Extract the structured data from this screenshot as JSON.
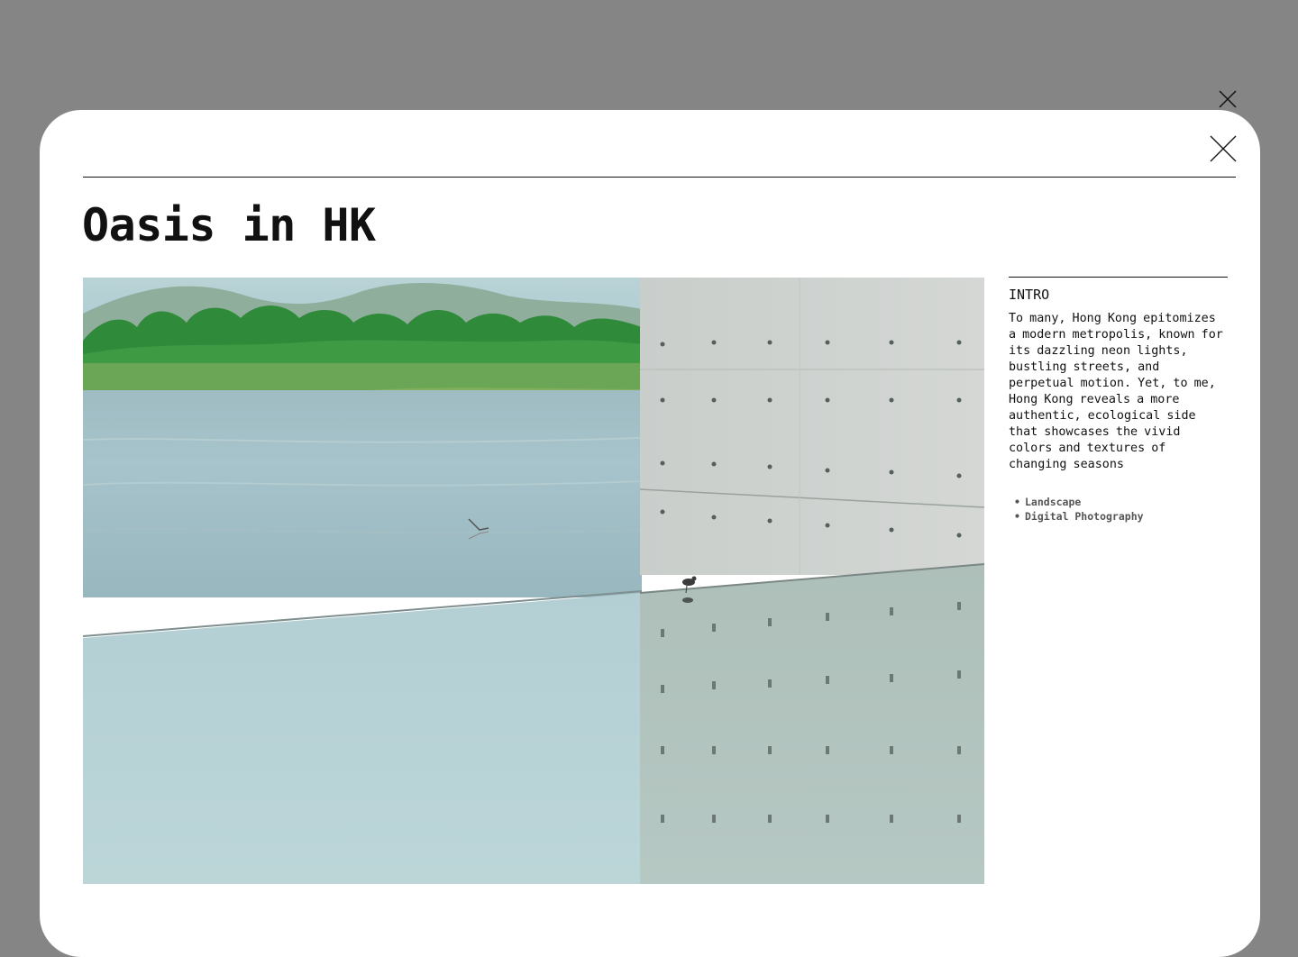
{
  "modal": {
    "title": "Oasis in HK"
  },
  "photo": {
    "subject": "lakeside wetland with concrete wall reflection"
  },
  "sidebar": {
    "section_label": "INTRO",
    "description": "To many, Hong Kong epitomizes a modern metropolis, known for its dazzling neon lights, bustling streets, and perpetual motion. Yet, to me, Hong Kong reveals a more authentic, ecological side that showcases the vivid colors and textures of changing seasons",
    "tags": [
      "Landscape",
      "Digital Photography"
    ]
  },
  "icons": {
    "outer_close": "close-icon",
    "modal_close": "close-icon"
  },
  "colors": {
    "backdrop": "#858585",
    "modal_background": "#ffffff",
    "text": "#111111",
    "tag_text": "#555555"
  }
}
